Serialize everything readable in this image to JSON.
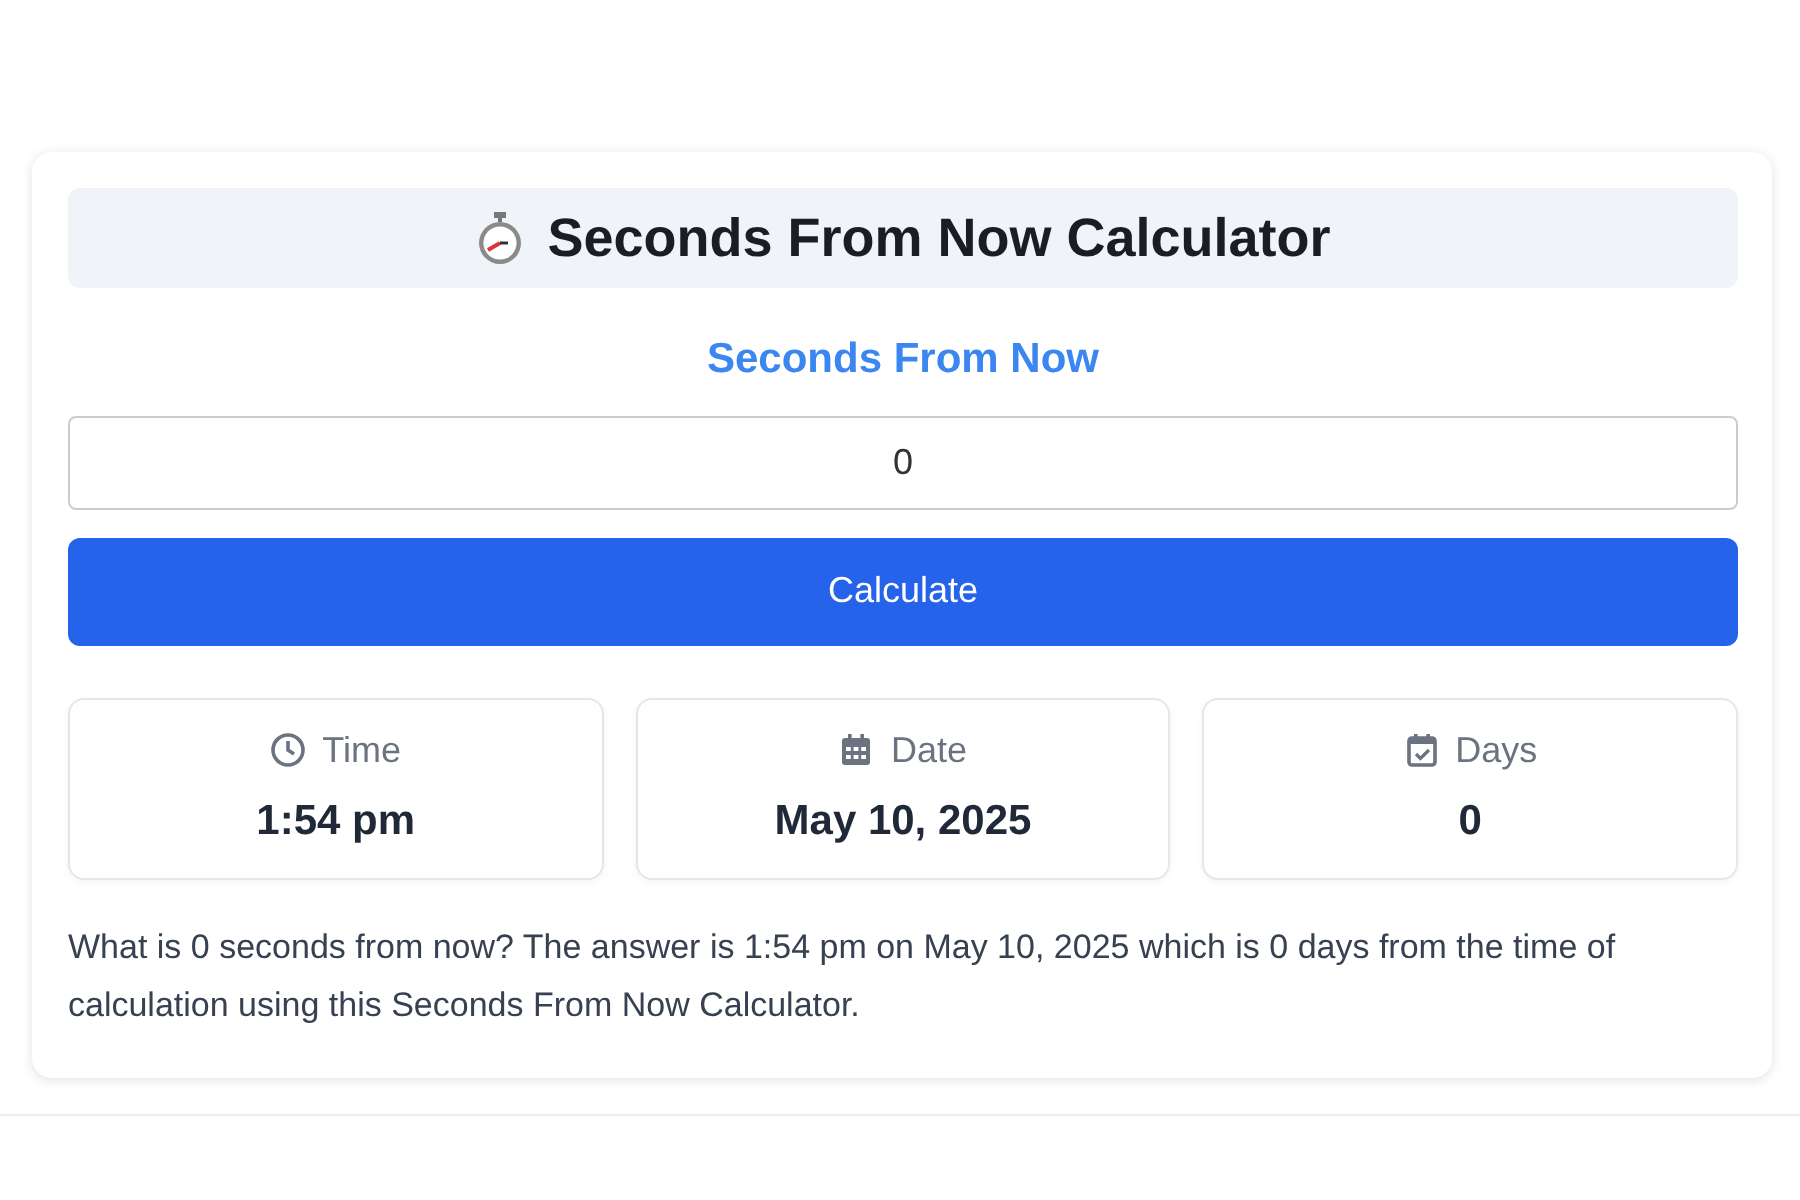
{
  "title": "Seconds From Now Calculator",
  "subtitle": "Seconds From Now",
  "input": {
    "value": "0"
  },
  "button": "Calculate",
  "results": [
    {
      "kind": "time",
      "label": "Time",
      "value": "1:54 pm"
    },
    {
      "kind": "date",
      "label": "Date",
      "value": "May 10, 2025"
    },
    {
      "kind": "days",
      "label": "Days",
      "value": "0"
    }
  ],
  "answer": "What is 0 seconds from now? The answer is 1:54 pm on May 10, 2025 which is 0 days from the time of calculation using this Seconds From Now Calculator."
}
